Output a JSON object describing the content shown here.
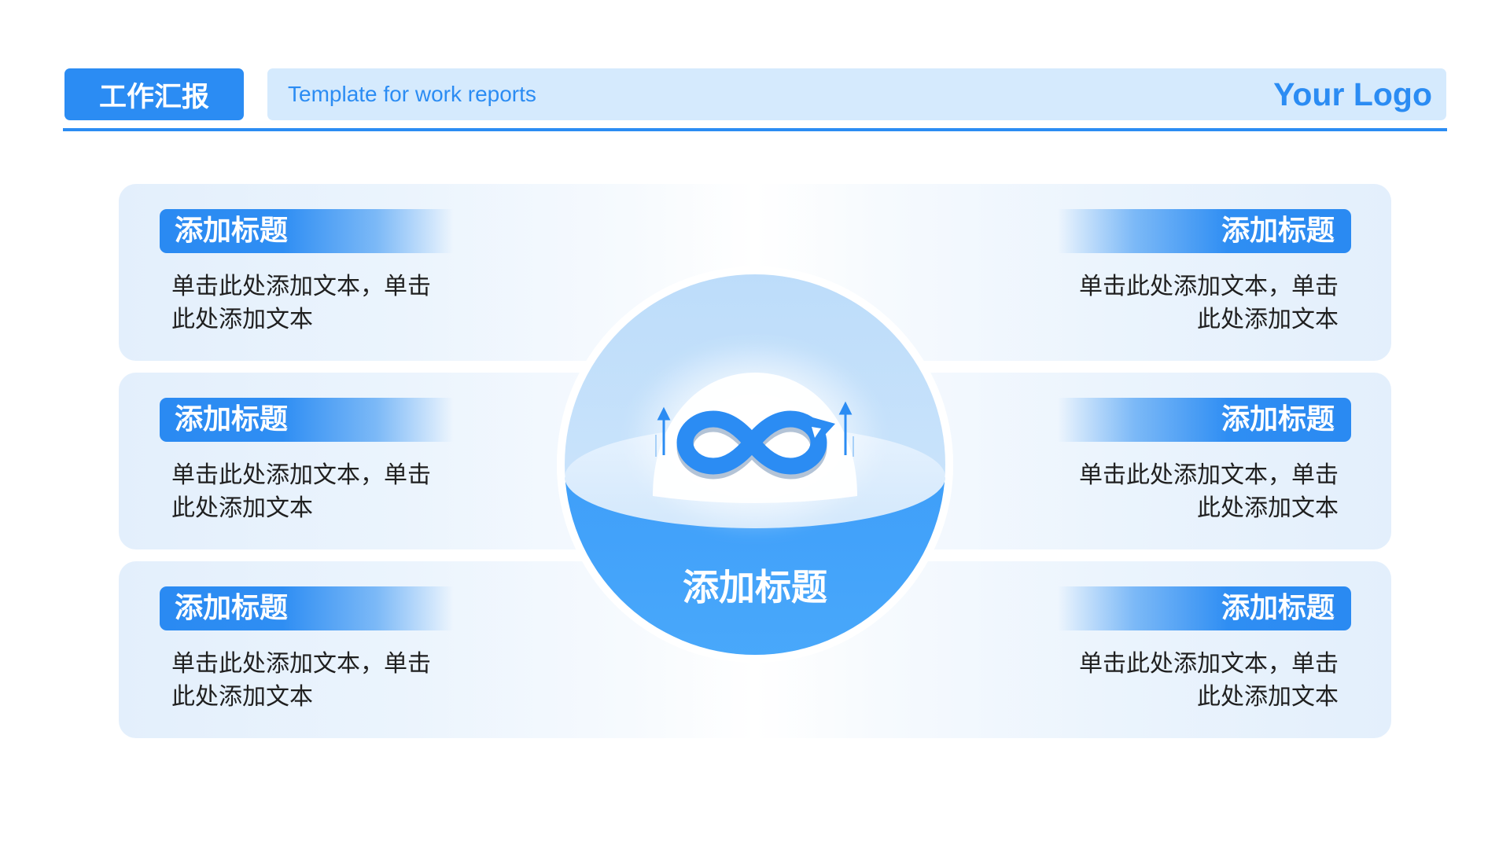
{
  "header": {
    "badge": "工作汇报",
    "subtitle": "Template for work reports",
    "logo": "Your Logo"
  },
  "center": {
    "title": "添加标题",
    "icon": "infinity-arrow-icon"
  },
  "left": [
    {
      "title": "添加标题",
      "lines": [
        "单击此处添加文本，单击",
        "此处添加文本"
      ]
    },
    {
      "title": "添加标题",
      "lines": [
        "单击此处添加文本，单击",
        "此处添加文本"
      ]
    },
    {
      "title": "添加标题",
      "lines": [
        "单击此处添加文本，单击",
        "此处添加文本"
      ]
    }
  ],
  "right": [
    {
      "title": "添加标题",
      "lines": [
        "单击此处添加文本，单击",
        "此处添加文本"
      ]
    },
    {
      "title": "添加标题",
      "lines": [
        "单击此处添加文本，单击",
        "此处添加文本"
      ]
    },
    {
      "title": "添加标题",
      "lines": [
        "单击此处添加文本，单击",
        "此处添加文本"
      ]
    }
  ],
  "colors": {
    "accent": "#2b8cf3",
    "topbar": "#d5eafd",
    "card": "#e4effc",
    "sphere_top": "#c1dffb",
    "sphere_bottom": "#46a4fb"
  }
}
